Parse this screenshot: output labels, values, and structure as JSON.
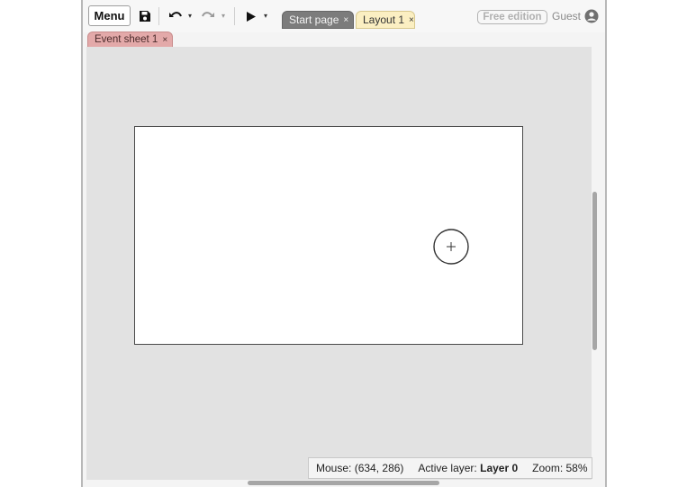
{
  "toolbar": {
    "menu_label": "Menu",
    "save_icon": "save-icon",
    "undo_icon": "undo-icon",
    "redo_icon": "redo-icon",
    "play_icon": "play-icon",
    "dropdown_glyph": "▾"
  },
  "tabs": [
    {
      "label": "Start page",
      "close": "×",
      "active": false
    },
    {
      "label": "Layout 1",
      "close": "×",
      "active": true
    },
    {
      "label": "Event sheet 1",
      "close": "×",
      "active": false
    }
  ],
  "account": {
    "edition_badge": "Free edition",
    "user_label": "Guest",
    "user_icon": "account-circle-icon"
  },
  "status": {
    "mouse_label": "Mouse:",
    "mouse_value": "(634, 286)",
    "layer_label": "Active layer:",
    "layer_value": "Layer 0",
    "zoom_label": "Zoom:",
    "zoom_value": "58%"
  },
  "colors": {
    "viewport_bg": "#e2e2e2",
    "tab_start_bg": "#7c7c7c",
    "tab_layout_bg": "#fbefc2",
    "tab_event_bg": "#e3a9a9"
  }
}
